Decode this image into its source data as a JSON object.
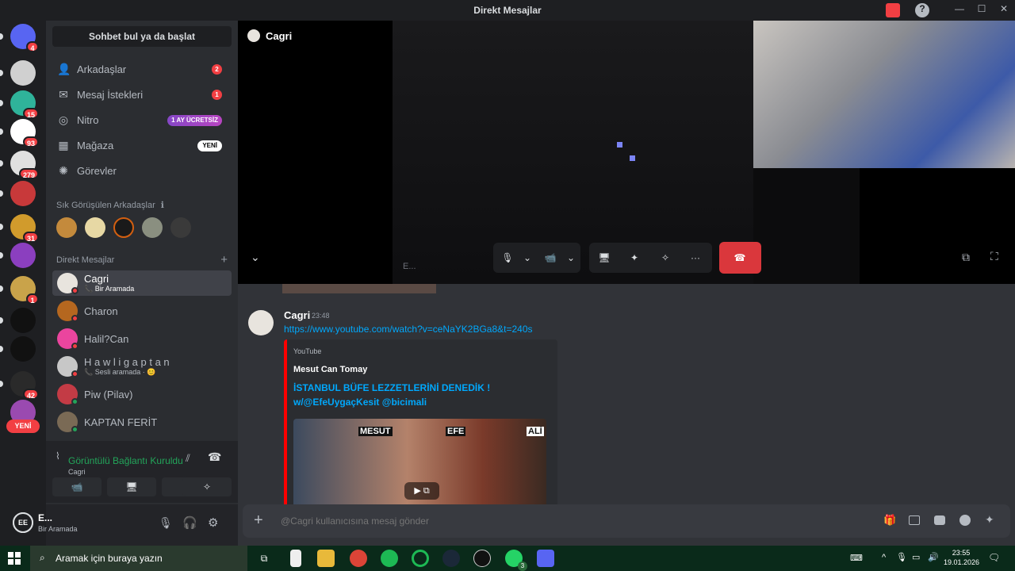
{
  "window": {
    "title": "Direkt Mesajlar",
    "min": "—",
    "max": "☐",
    "close": "✕",
    "help": "?"
  },
  "colors": {
    "accent": "#5865f2",
    "danger": "#f23f43",
    "online": "#23a55a",
    "link": "#00a8fc",
    "youtube": "#ff0000"
  },
  "guilds": [
    {
      "name": "discord-home",
      "badge": "4",
      "color": "#5865f2"
    },
    {
      "name": "server-1",
      "badge": "",
      "color": "#d0d0d0"
    },
    {
      "name": "server-2",
      "badge": "15",
      "color": "#2fb39a"
    },
    {
      "name": "server-3",
      "badge": "93",
      "color": "#ffffff"
    },
    {
      "name": "server-4",
      "badge": "279",
      "color": "#e0e0e0"
    },
    {
      "name": "server-5",
      "badge": "",
      "color": "#c8393a"
    },
    {
      "name": "server-6",
      "badge": "31",
      "color": "#d19b2c"
    },
    {
      "name": "server-7",
      "badge": "",
      "color": "#8b3fbf"
    },
    {
      "name": "server-8",
      "badge": "1",
      "color": "#c9a34a"
    },
    {
      "name": "server-9",
      "badge": "",
      "color": "#111111"
    },
    {
      "name": "server-10",
      "badge": "",
      "color": "#111111"
    },
    {
      "name": "server-11",
      "badge": "42",
      "color": "#2a2a2a"
    },
    {
      "name": "server-12",
      "badge": "",
      "color": "#9a4ab0"
    }
  ],
  "new_pill": "YENİ",
  "sidebar": {
    "search": "Sohbet bul ya da başlat",
    "nav": [
      {
        "label": "Arkadaşlar",
        "icon": "👤",
        "badge": "2"
      },
      {
        "label": "Mesaj İstekleri",
        "icon": "✉",
        "badge": "1"
      },
      {
        "label": "Nitro",
        "icon": "◎",
        "tag": "1 AY ÜCRETSİZ"
      },
      {
        "label": "Mağaza",
        "icon": "▦",
        "tag": "YENİ"
      },
      {
        "label": "Görevler",
        "icon": "✺"
      }
    ],
    "favorites_title": "Sık Görüşülen Arkadaşlar",
    "info_icon": "ℹ",
    "dm_title": "Direkt Mesajlar",
    "add": "+",
    "dms": [
      {
        "name": "Cagri",
        "sub": "📞 Bir Aramada",
        "color": "#e8e4de",
        "status": "#f23f43",
        "selected": true
      },
      {
        "name": "Charon",
        "sub": "",
        "color": "#b5671f",
        "status": "#f23f43"
      },
      {
        "name": "Halil?Can",
        "sub": "",
        "color": "#eb459e",
        "status": "#f23f43"
      },
      {
        "name": "H a w l i g a p t a n",
        "sub": "📞 Sesli aramada · 😊",
        "color": "#c7c7c7",
        "status": "#f23f43"
      },
      {
        "name": "Piw (Pilav)",
        "sub": "",
        "color": "#c33b45",
        "status": "#23a55a"
      },
      {
        "name": "KAPTAN FERİT",
        "sub": "",
        "color": "#7a6a55",
        "status": "#23a55a"
      }
    ],
    "voice": {
      "status": "Görüntülü Bağlantı Kuruldu",
      "channel": "Cagri",
      "buttons": [
        "📹",
        "🖥",
        "✦",
        "✧"
      ]
    },
    "user": {
      "name": "E...",
      "status": "Bir Aramada",
      "initials": "EE"
    }
  },
  "call": {
    "name": "Cagri",
    "caption": "E...",
    "controls": {
      "mic": "🎙",
      "caret": "⌄",
      "camera": "📹",
      "share": "🖥",
      "activity": "✦",
      "soundboard": "✧",
      "more": "···",
      "hangup": "☎"
    }
  },
  "message": {
    "author": "Cagri",
    "time": "23:48",
    "link": "https://www.youtube.com/watch?v=ceNaYK2BGa8&t=240s",
    "embed": {
      "provider": "YouTube",
      "author": "Mesut Can Tomay",
      "title": "İSTANBUL BÜFE LEZZETLERİNİ DENEDİK ! w/@EfeUygaçKesit @bicimali",
      "thumb_labels": [
        "MESUT",
        "EFE",
        "ALİ"
      ]
    }
  },
  "composer": {
    "placeholder": "@Cagri kullanıcısına mesaj gönder",
    "plus": "+"
  },
  "taskbar": {
    "search": "Aramak için buraya yazın",
    "time": "23:55",
    "date": "19.01.2026",
    "whatsapp_badge": "3"
  }
}
